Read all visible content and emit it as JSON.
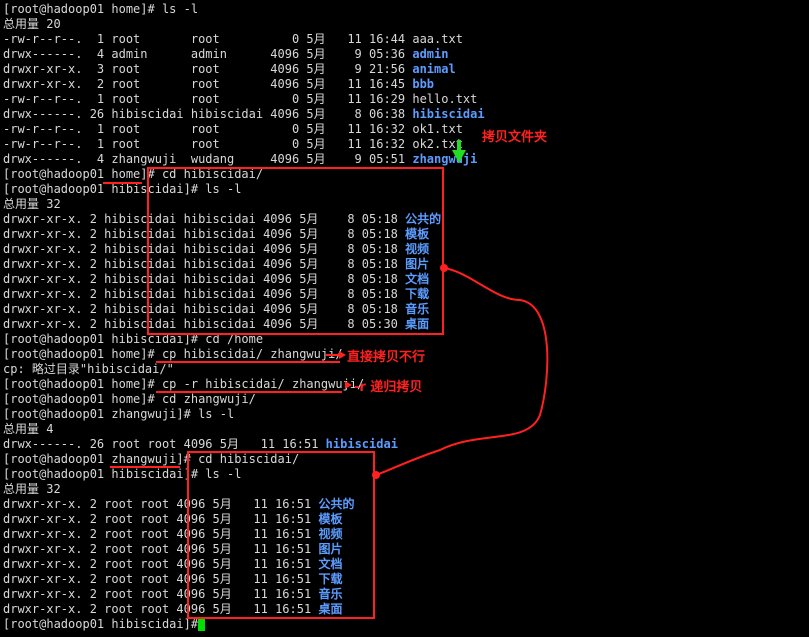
{
  "terminal": {
    "lines": [
      {
        "segments": [
          {
            "text": "[root@hadoop01 home]# ls -l"
          }
        ]
      },
      {
        "segments": [
          {
            "text": "总用量 20"
          }
        ]
      },
      {
        "segments": [
          {
            "text": "-rw-r--r--.  1 root       root          0 5月   11 16:44 aaa.txt"
          }
        ]
      },
      {
        "segments": [
          {
            "text": "drwx------.  4 admin      admin      4096 5月    9 05:36 "
          },
          {
            "text": "admin",
            "dir": true
          }
        ]
      },
      {
        "segments": [
          {
            "text": "drwxr-xr-x.  3 root       root       4096 5月    9 21:56 "
          },
          {
            "text": "animal",
            "dir": true
          }
        ]
      },
      {
        "segments": [
          {
            "text": "drwxr-xr-x.  2 root       root       4096 5月   11 16:45 "
          },
          {
            "text": "bbb",
            "dir": true
          }
        ]
      },
      {
        "segments": [
          {
            "text": "-rw-r--r--.  1 root       root          0 5月   11 16:29 hello.txt"
          }
        ]
      },
      {
        "segments": [
          {
            "text": "drwx------. 26 hibiscidai hibiscidai 4096 5月    8 06:38 "
          },
          {
            "text": "hibiscidai",
            "dir": true
          }
        ]
      },
      {
        "segments": [
          {
            "text": "-rw-r--r--.  1 root       root          0 5月   11 16:32 ok1.txt"
          }
        ]
      },
      {
        "segments": [
          {
            "text": "-rw-r--r--.  1 root       root          0 5月   11 16:32 ok2.txt"
          }
        ]
      },
      {
        "segments": [
          {
            "text": "drwx------.  4 zhangwuji  wudang     4096 5月    9 05:51 "
          },
          {
            "text": "zhangwuji",
            "dir": true
          }
        ]
      },
      {
        "segments": [
          {
            "text": "[root@hadoop01 home]# cd hibiscidai/"
          }
        ]
      },
      {
        "segments": [
          {
            "text": "[root@hadoop01 hibiscidai]# ls -l"
          }
        ]
      },
      {
        "segments": [
          {
            "text": "总用量 32"
          }
        ]
      },
      {
        "segments": [
          {
            "text": "drwxr-xr-x. 2 hibiscidai hibiscidai 4096 5月    8 05:18 "
          },
          {
            "text": "公共的",
            "dir": true
          }
        ]
      },
      {
        "segments": [
          {
            "text": "drwxr-xr-x. 2 hibiscidai hibiscidai 4096 5月    8 05:18 "
          },
          {
            "text": "模板",
            "dir": true
          }
        ]
      },
      {
        "segments": [
          {
            "text": "drwxr-xr-x. 2 hibiscidai hibiscidai 4096 5月    8 05:18 "
          },
          {
            "text": "视频",
            "dir": true
          }
        ]
      },
      {
        "segments": [
          {
            "text": "drwxr-xr-x. 2 hibiscidai hibiscidai 4096 5月    8 05:18 "
          },
          {
            "text": "图片",
            "dir": true
          }
        ]
      },
      {
        "segments": [
          {
            "text": "drwxr-xr-x. 2 hibiscidai hibiscidai 4096 5月    8 05:18 "
          },
          {
            "text": "文档",
            "dir": true
          }
        ]
      },
      {
        "segments": [
          {
            "text": "drwxr-xr-x. 2 hibiscidai hibiscidai 4096 5月    8 05:18 "
          },
          {
            "text": "下载",
            "dir": true
          }
        ]
      },
      {
        "segments": [
          {
            "text": "drwxr-xr-x. 2 hibiscidai hibiscidai 4096 5月    8 05:18 "
          },
          {
            "text": "音乐",
            "dir": true
          }
        ]
      },
      {
        "segments": [
          {
            "text": "drwxr-xr-x. 2 hibiscidai hibiscidai 4096 5月    8 05:30 "
          },
          {
            "text": "桌面",
            "dir": true
          }
        ]
      },
      {
        "segments": [
          {
            "text": "[root@hadoop01 hibiscidai]# cd /home"
          }
        ]
      },
      {
        "segments": [
          {
            "text": "[root@hadoop01 home]# cp hibiscidai/ zhangwuji/"
          }
        ]
      },
      {
        "segments": [
          {
            "text": "cp: 略过目录\"hibiscidai/\""
          }
        ]
      },
      {
        "segments": [
          {
            "text": "[root@hadoop01 home]# cp -r hibiscidai/ zhangwuji/"
          }
        ]
      },
      {
        "segments": [
          {
            "text": "[root@hadoop01 home]# cd zhangwuji/"
          }
        ]
      },
      {
        "segments": [
          {
            "text": "[root@hadoop01 zhangwuji]# ls -l"
          }
        ]
      },
      {
        "segments": [
          {
            "text": "总用量 4"
          }
        ]
      },
      {
        "segments": [
          {
            "text": "drwx------. 26 root root 4096 5月   11 16:51 "
          },
          {
            "text": "hibiscidai",
            "dir": true
          }
        ]
      },
      {
        "segments": [
          {
            "text": "[root@hadoop01 zhangwuji]# cd hibiscidai/"
          }
        ]
      },
      {
        "segments": [
          {
            "text": "[root@hadoop01 hibiscidai]# ls -l"
          }
        ]
      },
      {
        "segments": [
          {
            "text": "总用量 32"
          }
        ]
      },
      {
        "segments": [
          {
            "text": "drwxr-xr-x. 2 root root 4096 5月   11 16:51 "
          },
          {
            "text": "公共的",
            "dir": true
          }
        ]
      },
      {
        "segments": [
          {
            "text": "drwxr-xr-x. 2 root root 4096 5月   11 16:51 "
          },
          {
            "text": "模板",
            "dir": true
          }
        ]
      },
      {
        "segments": [
          {
            "text": "drwxr-xr-x. 2 root root 4096 5月   11 16:51 "
          },
          {
            "text": "视频",
            "dir": true
          }
        ]
      },
      {
        "segments": [
          {
            "text": "drwxr-xr-x. 2 root root 4096 5月   11 16:51 "
          },
          {
            "text": "图片",
            "dir": true
          }
        ]
      },
      {
        "segments": [
          {
            "text": "drwxr-xr-x. 2 root root 4096 5月   11 16:51 "
          },
          {
            "text": "文档",
            "dir": true
          }
        ]
      },
      {
        "segments": [
          {
            "text": "drwxr-xr-x. 2 root root 4096 5月   11 16:51 "
          },
          {
            "text": "下载",
            "dir": true
          }
        ]
      },
      {
        "segments": [
          {
            "text": "drwxr-xr-x. 2 root root 4096 5月   11 16:51 "
          },
          {
            "text": "音乐",
            "dir": true
          }
        ]
      },
      {
        "segments": [
          {
            "text": "drwxr-xr-x. 2 root root 4096 5月   11 16:51 "
          },
          {
            "text": "桌面",
            "dir": true
          }
        ]
      },
      {
        "segments": [
          {
            "text": "[root@hadoop01 hibiscidai]# "
          }
        ]
      }
    ]
  },
  "annotations": {
    "copy_folder": "拷贝文件夹",
    "direct_copy_fails": "直接拷贝不行",
    "recursive_copy": "-r 递归拷贝"
  },
  "colors": {
    "background": "#000000",
    "text": "#d8d8d8",
    "directory": "#5c9cff",
    "annotation": "#ff2020",
    "arrow": "#22dd22",
    "cursor": "#00e000"
  }
}
